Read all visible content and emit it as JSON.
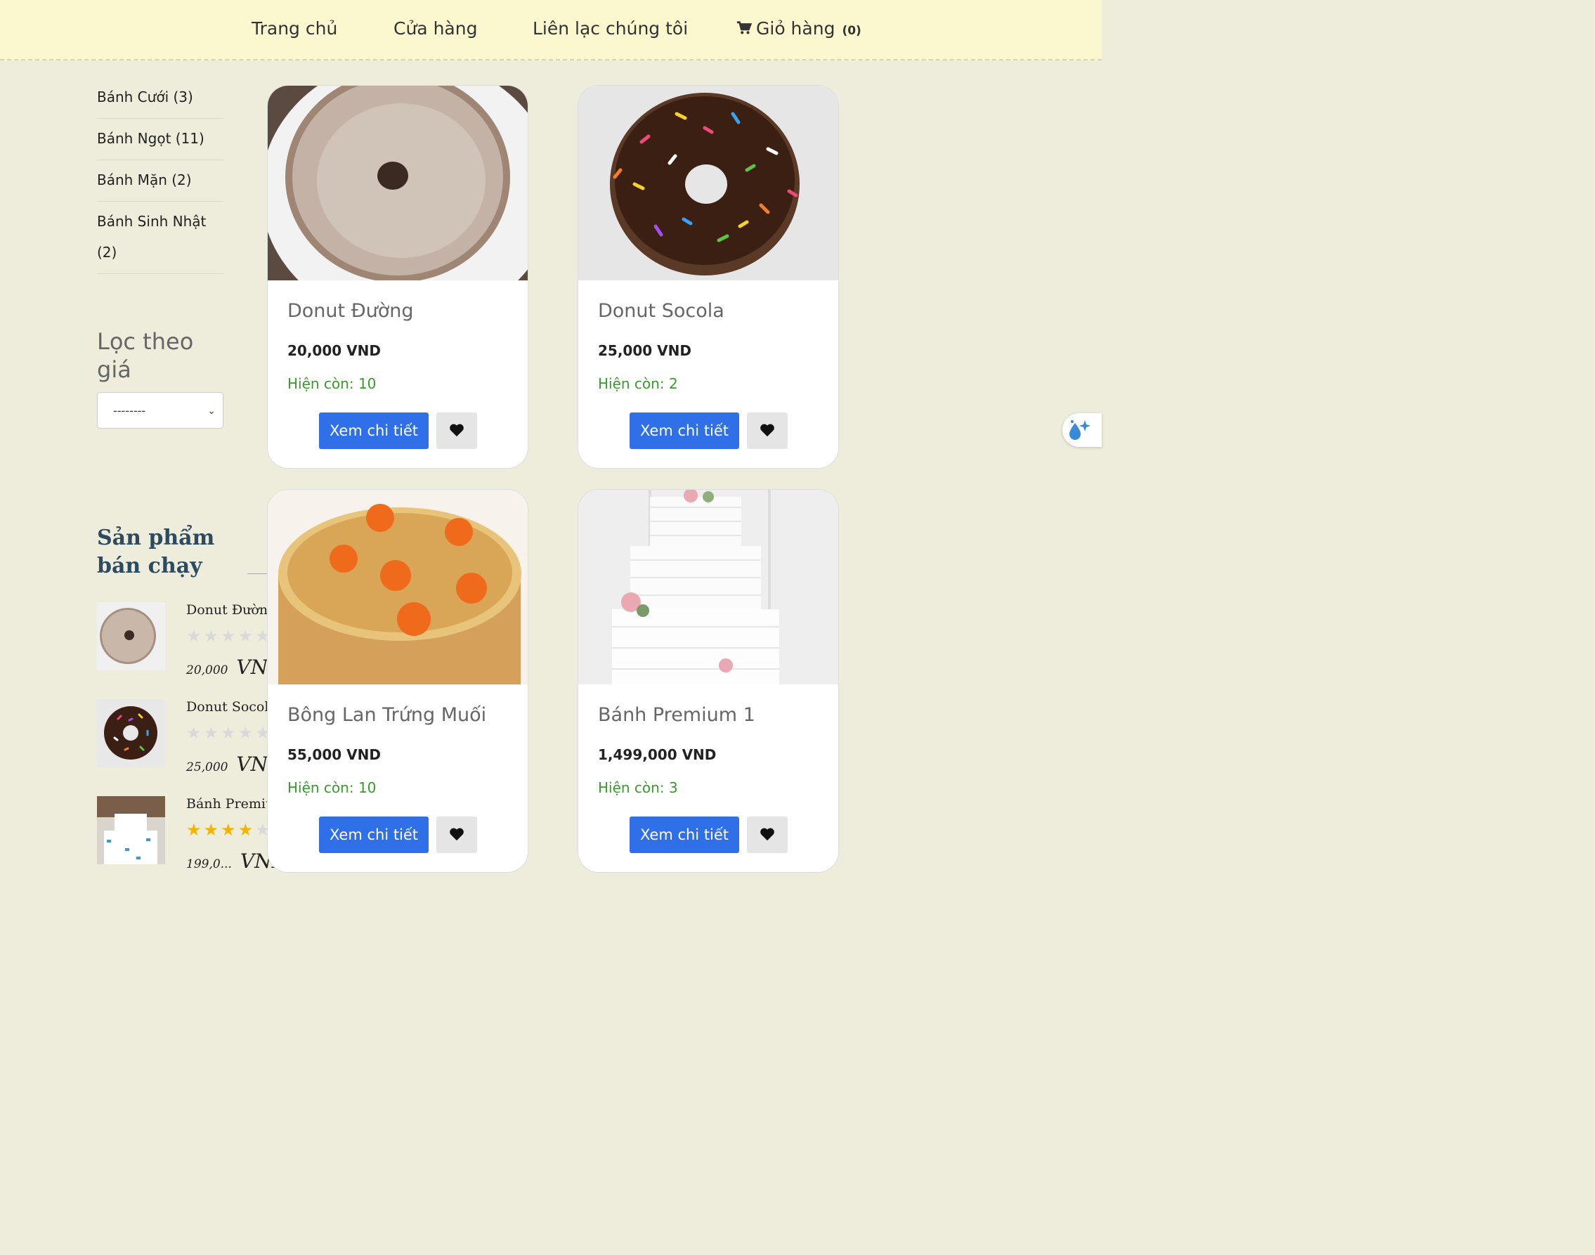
{
  "nav": {
    "home": "Trang chủ",
    "shop": "Cửa hàng",
    "contact": "Liên lạc chúng tôi",
    "cart": "Giỏ hàng",
    "cart_count": "(0)"
  },
  "sidebar": {
    "categories": [
      {
        "label": "Bánh Cưới (3)"
      },
      {
        "label": "Bánh Ngọt (11)"
      },
      {
        "label": "Bánh Mặn (2)"
      },
      {
        "label": "Bánh Sinh Nhật"
      },
      {
        "label": "(2)"
      }
    ],
    "filter_title": "Lọc theo giá",
    "price_select_value": "--------",
    "best_sellers_title": "Sản phẩm bán chạy",
    "best_sellers": [
      {
        "name": "Donut Đường",
        "price": "20,000",
        "currency": "VND",
        "rating": 0
      },
      {
        "name": "Donut Socola",
        "price": "25,000",
        "currency": "VND",
        "rating": 0
      },
      {
        "name": "Bánh Premiu...",
        "price": "199,0...",
        "currency": "VND",
        "rating": 4
      }
    ]
  },
  "products": [
    {
      "name": "Donut Đường",
      "price": "20,000 VND",
      "stock": "Hiện còn: 10",
      "detail_label": "Xem chi tiết"
    },
    {
      "name": "Donut Socola",
      "price": "25,000 VND",
      "stock": "Hiện còn: 2",
      "detail_label": "Xem chi tiết"
    },
    {
      "name": "Bông Lan Trứng Muối",
      "price": "55,000 VND",
      "stock": "Hiện còn: 10",
      "detail_label": "Xem chi tiết"
    },
    {
      "name": "Bánh Premium 1",
      "price": "1,499,000 VND",
      "stock": "Hiện còn: 3",
      "detail_label": "Xem chi tiết"
    }
  ],
  "colors": {
    "nav_bg": "#fbf8cf",
    "page_bg": "#eeeddc",
    "primary_button": "#2f6fe8",
    "stock_text": "#3a9a2e",
    "best_title": "#2c4a60",
    "star_on": "#f4b400"
  },
  "icons": {
    "cart": "cart-icon",
    "heart": "heart-icon",
    "chevron": "chevron-down-icon",
    "float": "droplet-sparkle-icon"
  }
}
